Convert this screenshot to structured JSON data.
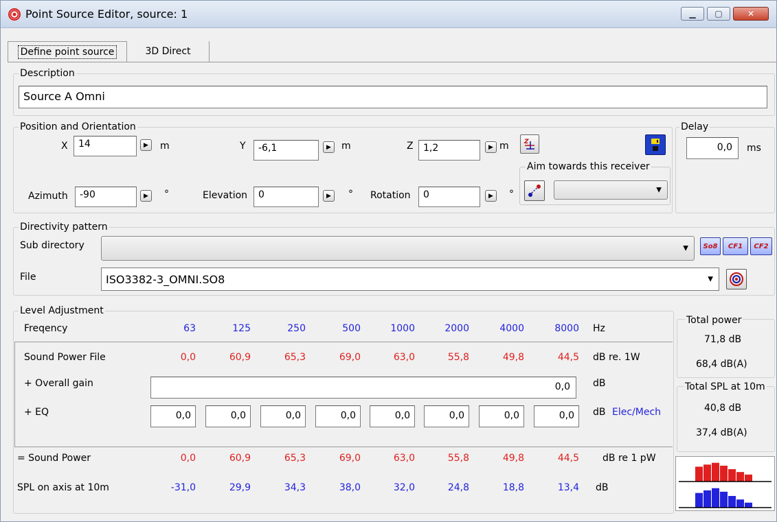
{
  "window": {
    "title": "Point Source Editor, source: 1"
  },
  "tabs": [
    {
      "label": "Define point source"
    },
    {
      "label": "3D Direct"
    }
  ],
  "description": {
    "label": "Description",
    "value": "Source A Omni"
  },
  "position": {
    "label": "Position and Orientation",
    "x_label": "X",
    "x_value": "14",
    "y_label": "Y",
    "y_value": "-6,1",
    "z_label": "Z",
    "z_value": "1,2",
    "unit_m": "m",
    "azimuth_label": "Azimuth",
    "azimuth_value": "-90",
    "elevation_label": "Elevation",
    "elevation_value": "0",
    "rotation_label": "Rotation",
    "rotation_value": "0",
    "deg": "°",
    "aim_label": "Aim towards this receiver"
  },
  "delay": {
    "label": "Delay",
    "value": "0,0",
    "unit": "ms"
  },
  "directivity": {
    "label": "Directivity pattern",
    "subdir_label": "Sub directory",
    "file_label": "File",
    "file_value": "ISO3382-3_OMNI.SO8",
    "buttons": [
      "So8",
      "CF1",
      "CF2"
    ]
  },
  "level": {
    "label": "Level Adjustment",
    "freq_label": "Freqency",
    "frequencies": [
      "63",
      "125",
      "250",
      "500",
      "1000",
      "2000",
      "4000",
      "8000"
    ],
    "hz": "Hz",
    "sound_power_file_label": "Sound Power File",
    "sound_power_file": [
      "0,0",
      "60,9",
      "65,3",
      "69,0",
      "63,0",
      "55,8",
      "49,8",
      "44,5"
    ],
    "sound_power_file_unit": "dB  re. 1W",
    "overall_gain_label": "+ Overall gain",
    "overall_gain_value": "0,0",
    "overall_gain_unit": "dB",
    "eq_label": "+ EQ",
    "eq_values": [
      "0,0",
      "0,0",
      "0,0",
      "0,0",
      "0,0",
      "0,0",
      "0,0",
      "0,0"
    ],
    "eq_unit": "dB",
    "eq_link": "Elec/Mech",
    "sound_power_label": "= Sound Power",
    "sound_power": [
      "0,0",
      "60,9",
      "65,3",
      "69,0",
      "63,0",
      "55,8",
      "49,8",
      "44,5"
    ],
    "sound_power_unit": "dB re 1 pW",
    "spl_label": "SPL on axis at 10m",
    "spl": [
      "-31,0",
      "29,9",
      "34,3",
      "38,0",
      "32,0",
      "24,8",
      "18,8",
      "13,4"
    ],
    "spl_unit": "dB"
  },
  "totals": {
    "power_label": "Total power",
    "power_db": "71,8 dB",
    "power_dba": "68,4 dB(A)",
    "spl_label": "Total SPL at 10m",
    "spl_db": "40,8 dB",
    "spl_dba": "37,4 dB(A)"
  },
  "colors": {
    "power": "#e02020",
    "spl": "#2323dd",
    "accent_link": "#2323dd"
  },
  "icons": {
    "title": "target-icon",
    "coord": "coordinate-swap-icon",
    "save": "save-disk-icon",
    "aim": "aim-receiver-icon",
    "directivity": "directivity-target-icon"
  }
}
